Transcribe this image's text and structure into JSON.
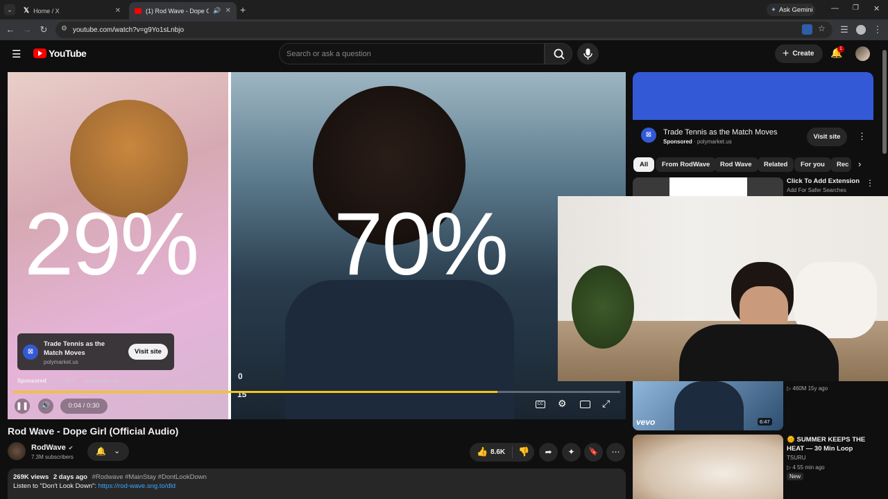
{
  "browser": {
    "tabs": [
      {
        "label": "Home / X",
        "icon": "x-logo-icon",
        "active": false
      },
      {
        "label": "(1) Rod Wave - Dope Girl (O",
        "icon": "youtube-favicon-icon",
        "active": true
      }
    ],
    "new_tab": "+",
    "ask_gemini": "Ask Gemini",
    "url": "youtube.com/watch?v=g9Yo1sLnbjo"
  },
  "youtube": {
    "logo_text": "YouTube",
    "search_placeholder": "Search or ask a question",
    "create_label": "Create",
    "notification_count": "1"
  },
  "video": {
    "left_percent": "29%",
    "right_percent": "70%",
    "score_top": "0",
    "score_bottom": "15",
    "ad_card": {
      "title_line1": "Trade Tennis as the",
      "title_line2": "Match Moves",
      "domain": "polymarket.us",
      "cta": "Visit site"
    },
    "sponsored_label": "Sponsored",
    "ad_counter": "1 of 2",
    "ad_domain": "polymarket.us",
    "time": "0:04 / 0:30",
    "progress": 0.133,
    "title": "Rod Wave - Dope Girl (Official Audio)",
    "channel": {
      "name": "RodWave",
      "subscribers": "7.3M subscribers"
    },
    "likes": "8.6K",
    "description": {
      "views": "269K views",
      "age": "2 days ago",
      "tags": "#Rodwave #MainStay #DontLookDown",
      "line2_prefix": "Listen to \"Don't Look Down\": ",
      "link": "https://rod-wave.sng.to/dld"
    }
  },
  "sidebar": {
    "ad": {
      "title": "Trade Tennis as the Match Moves",
      "sponsored": "Sponsored",
      "domain": "polymarket.us",
      "cta": "Visit site",
      "banner_color": "#3359d7"
    },
    "chips": [
      "All",
      "From RodWave",
      "Rod Wave",
      "Related",
      "For you",
      "Rec"
    ],
    "items": [
      {
        "title": "Click To Add Extension",
        "sub": "Add For Safer Searches"
      },
      {
        "meta": "460M  15y ago",
        "duration": "6:47",
        "badge": "vevo"
      },
      {
        "title": "SUMMER KEEPS THE HEAT — 30 Min Loop",
        "channel": "TSURU",
        "meta": "4  55 min ago",
        "new": "New"
      }
    ]
  },
  "colors": {
    "accent_red": "#ff0000",
    "progress_yellow": "#f5c518",
    "link_blue": "#3ea6ff"
  }
}
